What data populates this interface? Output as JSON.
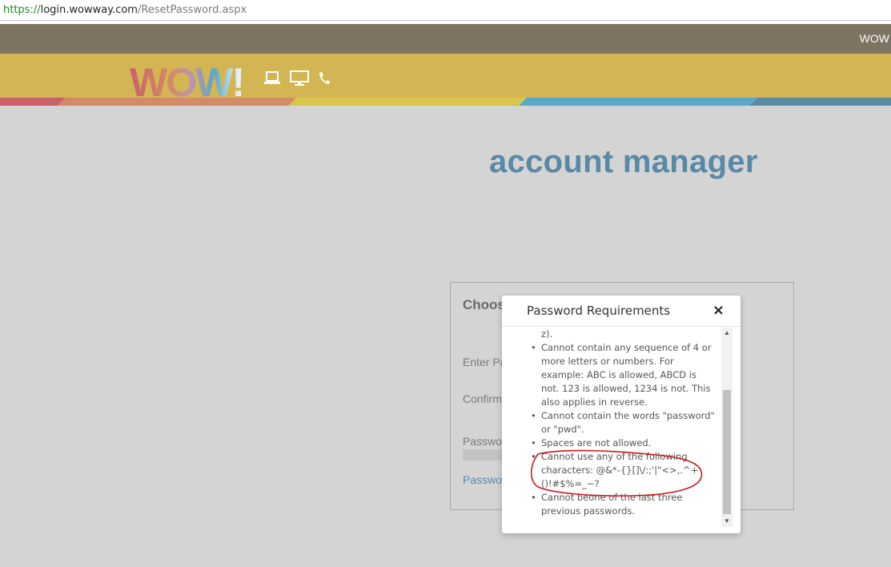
{
  "browser": {
    "url_scheme": "https://",
    "url_host": "login.wowway.com",
    "url_path": "/ResetPassword.aspx"
  },
  "topnav": {
    "link_label": "WOW"
  },
  "brand": {
    "logo_text": "WOW!"
  },
  "header_icons": [
    "laptop-icon",
    "monitor-icon",
    "phone-icon"
  ],
  "colors": {
    "topnav": "#7d7462",
    "header": "#d4b553",
    "heading": "#5889a6",
    "stripe": [
      "#c9606b",
      "#d38a66",
      "#d7c64b",
      "#5aa9c9",
      "#5b8ca6"
    ]
  },
  "page": {
    "heading": "account manager"
  },
  "form": {
    "title": "Choos",
    "enter_label": "Enter Pa",
    "confirm_label": "Confirm",
    "strength_label": "Passwo",
    "requirements_link": "Passwo"
  },
  "modal": {
    "title": "Password Requirements",
    "close_label": "×",
    "items": [
      {
        "text": "z).",
        "bullet": false
      },
      {
        "text": "Cannot contain any sequence of 4 or more letters or numbers. For example: ABC is allowed, ABCD is not. 123 is allowed, 1234 is not. This also applies in reverse.",
        "bullet": true
      },
      {
        "text": "Cannot contain the words \"password\" or \"pwd\".",
        "bullet": true
      },
      {
        "text": "Spaces are not allowed.",
        "bullet": true
      },
      {
        "text": "Cannot use any of the following characters: @&*-{}[]\\/:;'|\"<>,.^+()!#$%=_~?",
        "bullet": true
      },
      {
        "text": "Cannot beone of the last three previous passwords.",
        "bullet": true
      }
    ]
  }
}
